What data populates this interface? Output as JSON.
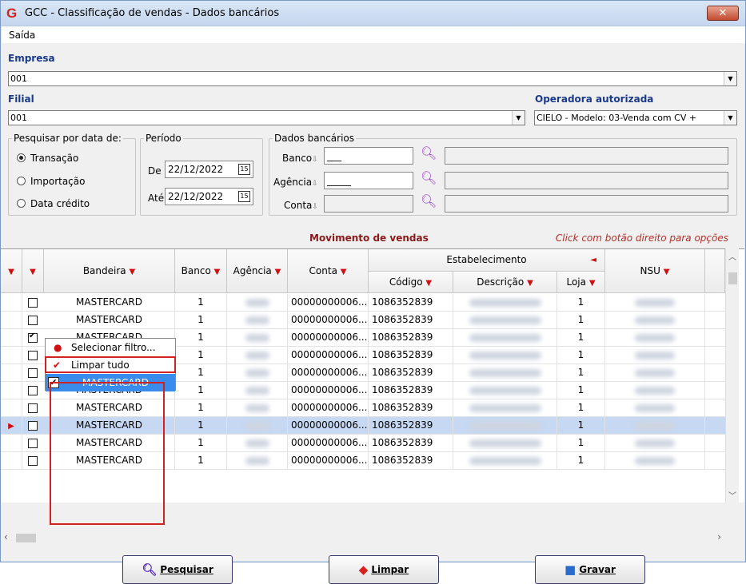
{
  "window": {
    "title": "GCC - Classificação de vendas - Dados bancários",
    "close_label": "✕",
    "app_icon": "G"
  },
  "menu": {
    "items": [
      "Saída"
    ]
  },
  "empresa": {
    "label": "Empresa",
    "value": "001"
  },
  "filial": {
    "label": "Filial",
    "value": "001"
  },
  "operadora": {
    "label": "Operadora autorizada",
    "value": "CIELO - Modelo: 03-Venda com CV +"
  },
  "pesquisar": {
    "legend": "Pesquisar por data de:",
    "options": [
      "Transação",
      "Importação",
      "Data crédito"
    ],
    "selected": "Transação"
  },
  "periodo": {
    "legend": "Período",
    "de_label": "De",
    "de_value": "22/12/2022",
    "ate_label": "Até",
    "ate_value": "22/12/2022",
    "cal_icon": "15"
  },
  "dados": {
    "legend": "Dados bancários",
    "banco_label": "Banco",
    "banco_value": "___",
    "agencia_label": "Agência",
    "agencia_value": "_____",
    "conta_label": "Conta",
    "conta_value": "",
    "sort_icon": "⇩"
  },
  "grid": {
    "title": "Movimento de vendas",
    "hint": "Click com botão direito para opções",
    "headers": {
      "bandeira": "Bandeira",
      "banco": "Banco",
      "agencia": "Agência",
      "conta": "Conta",
      "estabelecimento": "Estabelecimento",
      "codigo": "Código",
      "descricao": "Descrição",
      "loja": "Loja",
      "nsu": "NSU"
    },
    "rows": [
      {
        "bandeira": "MASTERCARD",
        "banco": "1",
        "conta": "00000000006...",
        "codigo": "1086352839",
        "loja": "1",
        "checked": false
      },
      {
        "bandeira": "MASTERCARD",
        "banco": "1",
        "conta": "00000000006...",
        "codigo": "1086352839",
        "loja": "1",
        "checked": false
      },
      {
        "bandeira": "MASTERCARD",
        "banco": "1",
        "conta": "00000000006...",
        "codigo": "1086352839",
        "loja": "1",
        "checked": true
      },
      {
        "bandeira": "MASTERCARD",
        "banco": "1",
        "conta": "00000000006...",
        "codigo": "1086352839",
        "loja": "1",
        "checked": false
      },
      {
        "bandeira": "MASTERCARD",
        "banco": "1",
        "conta": "00000000006...",
        "codigo": "1086352839",
        "loja": "1",
        "checked": false
      },
      {
        "bandeira": "MASTERCARD",
        "banco": "1",
        "conta": "00000000006...",
        "codigo": "1086352839",
        "loja": "1",
        "checked": false
      },
      {
        "bandeira": "MASTERCARD",
        "banco": "1",
        "conta": "00000000006...",
        "codigo": "1086352839",
        "loja": "1",
        "checked": false
      },
      {
        "bandeira": "MASTERCARD",
        "banco": "1",
        "conta": "00000000006...",
        "codigo": "1086352839",
        "loja": "1",
        "checked": false
      },
      {
        "bandeira": "MASTERCARD",
        "banco": "1",
        "conta": "00000000006...",
        "codigo": "1086352839",
        "loja": "1",
        "checked": false
      },
      {
        "bandeira": "MASTERCARD",
        "banco": "1",
        "conta": "00000000006...",
        "codigo": "1086352839",
        "loja": "1",
        "checked": false
      }
    ],
    "selected_row": 7,
    "filter_popup": {
      "items": [
        "Selecionar filtro...",
        "Limpar tudo",
        "MASTERCARD"
      ]
    }
  },
  "buttons": {
    "pesquisar": "Pesquisar",
    "limpar": "Limpar",
    "gravar": "Gravar"
  },
  "colors": {
    "accent_blue": "#1a3a8a",
    "filter_red": "#d01010",
    "selected_row": "#c6d8f2",
    "highlight": "#d32020"
  }
}
